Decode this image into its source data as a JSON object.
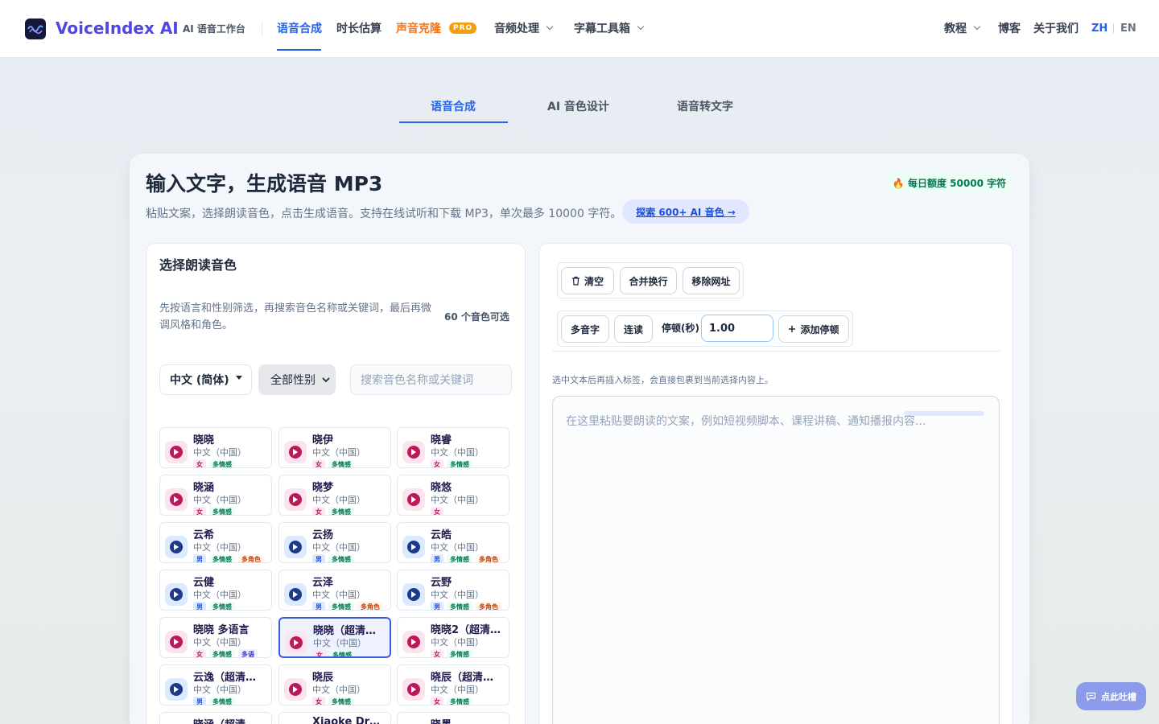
{
  "header": {
    "brand": "VoiceIndex AI",
    "subbrand": "AI 语音工作台",
    "nav": {
      "tts": "语音合成",
      "duration": "时长估算",
      "clone": "声音克隆",
      "pro_badge": "PRO",
      "audio": "音频处理",
      "subtitle": "字幕工具箱"
    },
    "right": {
      "tutorial": "教程",
      "blog": "博客",
      "about": "关于我们",
      "lang_zh": "ZH",
      "lang_en": "EN"
    }
  },
  "tabs": [
    "语音合成",
    "AI 音色设计",
    "语音转文字"
  ],
  "hero": {
    "title": "输入文字，生成语音 MP3",
    "desc": "粘贴文案，选择朗读音色，点击生成语音。支持在线试听和下载 MP3，单次最多 10000 字符。",
    "explore": "探索 600+ AI 音色 →",
    "quota": "🔥 每日额度 50000 字符"
  },
  "voice_panel": {
    "title": "选择朗读音色",
    "hint": "先按语言和性别筛选，再搜索音色名称或关键词，最后再微调风格和角色。",
    "count": "60 个音色可选",
    "language": "中文 (简体)",
    "gender_options": [
      "全部性别"
    ],
    "search_placeholder": "搜索音色名称或关键词",
    "voices": [
      {
        "name": "晓晓",
        "locale": "中文（中国）",
        "gender": "f",
        "tags": [
          [
            "女",
            "f"
          ],
          [
            "多情感",
            "e"
          ]
        ]
      },
      {
        "name": "晓伊",
        "locale": "中文（中国）",
        "gender": "f",
        "tags": [
          [
            "女",
            "f"
          ],
          [
            "多情感",
            "e"
          ]
        ]
      },
      {
        "name": "晓睿",
        "locale": "中文（中国）",
        "gender": "f",
        "tags": [
          [
            "女",
            "f"
          ],
          [
            "多情感",
            "e"
          ]
        ]
      },
      {
        "name": "晓涵",
        "locale": "中文（中国）",
        "gender": "f",
        "tags": [
          [
            "女",
            "f"
          ],
          [
            "多情感",
            "e"
          ]
        ]
      },
      {
        "name": "晓梦",
        "locale": "中文（中国）",
        "gender": "f",
        "tags": [
          [
            "女",
            "f"
          ],
          [
            "多情感",
            "e"
          ]
        ]
      },
      {
        "name": "晓悠",
        "locale": "中文（中国）",
        "gender": "f",
        "tags": [
          [
            "女",
            "f"
          ]
        ]
      },
      {
        "name": "云希",
        "locale": "中文（中国）",
        "gender": "m",
        "tags": [
          [
            "男",
            "m"
          ],
          [
            "多情感",
            "e"
          ],
          [
            "多角色",
            "r"
          ]
        ]
      },
      {
        "name": "云扬",
        "locale": "中文（中国）",
        "gender": "m",
        "tags": [
          [
            "男",
            "m"
          ],
          [
            "多情感",
            "e"
          ]
        ]
      },
      {
        "name": "云皓",
        "locale": "中文（中国）",
        "gender": "m",
        "tags": [
          [
            "男",
            "m"
          ],
          [
            "多情感",
            "e"
          ],
          [
            "多角色",
            "r"
          ]
        ]
      },
      {
        "name": "云健",
        "locale": "中文（中国）",
        "gender": "m",
        "tags": [
          [
            "男",
            "m"
          ],
          [
            "多情感",
            "e"
          ]
        ]
      },
      {
        "name": "云泽",
        "locale": "中文（中国）",
        "gender": "m",
        "tags": [
          [
            "男",
            "m"
          ],
          [
            "多情感",
            "e"
          ],
          [
            "多角色",
            "r"
          ]
        ]
      },
      {
        "name": "云野",
        "locale": "中文（中国）",
        "gender": "m",
        "tags": [
          [
            "男",
            "m"
          ],
          [
            "多情感",
            "e"
          ],
          [
            "多角色",
            "r"
          ]
        ]
      },
      {
        "name": "晓晓 多语言",
        "locale": "中文（中国）",
        "gender": "f",
        "tags": [
          [
            "女",
            "f"
          ],
          [
            "多情感",
            "e"
          ],
          [
            "多语",
            "l"
          ]
        ]
      },
      {
        "name": "晓晓（超清…",
        "locale": "中文（中国）",
        "gender": "f",
        "selected": true,
        "tags": [
          [
            "女",
            "f"
          ],
          [
            "多情感",
            "e"
          ]
        ]
      },
      {
        "name": "晓晓2（超清…",
        "locale": "中文（中国）",
        "gender": "f",
        "tags": [
          [
            "女",
            "f"
          ],
          [
            "多情感",
            "e"
          ]
        ]
      },
      {
        "name": "云逸（超清…",
        "locale": "中文（中国）",
        "gender": "m",
        "tags": [
          [
            "男",
            "m"
          ],
          [
            "多情感",
            "e"
          ]
        ]
      },
      {
        "name": "晓辰",
        "locale": "中文（中国）",
        "gender": "f",
        "tags": [
          [
            "女",
            "f"
          ],
          [
            "多情感",
            "e"
          ]
        ]
      },
      {
        "name": "晓辰（超清…",
        "locale": "中文（中国）",
        "gender": "f",
        "tags": [
          [
            "女",
            "f"
          ],
          [
            "多情感",
            "e"
          ]
        ]
      },
      {
        "name": "晓涵（超清…",
        "locale": "",
        "gender": "f",
        "tags": []
      },
      {
        "name": "Xiaoke Dr…",
        "locale": "",
        "gender": "f",
        "tags": []
      },
      {
        "name": "晓墨…",
        "locale": "",
        "gender": "f",
        "tags": []
      }
    ]
  },
  "editor": {
    "clear": "清空",
    "merge": "合并换行",
    "remove_url": "移除网址",
    "polyphone": "多音字",
    "liaison": "连读",
    "pause_label": "停顿(秒)",
    "pause_value": "1.00",
    "add_pause": "添加停顿",
    "tip": "选中文本后再插入标签，会直接包裹到当前选择内容上。",
    "placeholder": "在这里粘贴要朗读的文案，例如短视频脚本、课程讲稿、通知播报内容..."
  },
  "feedback": "点此吐槽"
}
